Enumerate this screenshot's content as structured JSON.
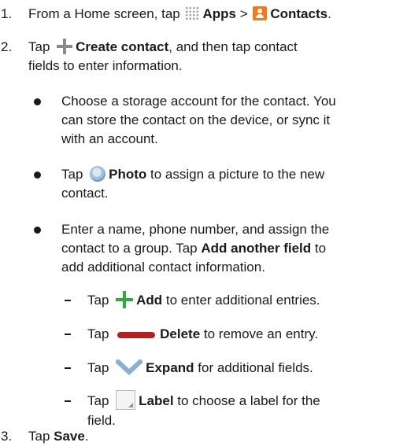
{
  "colors": {
    "contacts_icon": "#f07a1e",
    "add_icon": "#2eaa3e",
    "delete_icon": "#b32020",
    "expand_icon": "#8ab1cf",
    "create_icon": "#8a8a8a"
  },
  "icons": [
    "apps-grid-icon",
    "contacts-icon",
    "plus-icon",
    "photo-icon",
    "add-icon",
    "delete-icon",
    "expand-icon",
    "label-icon"
  ],
  "steps": [
    {
      "number": "1.",
      "prefix": "From a Home screen, tap ",
      "apps": "Apps",
      "sep": " > ",
      "contacts": "Contacts",
      "suffix": "."
    },
    {
      "number": "2.",
      "prefix": "Tap ",
      "create": "Create contact",
      "line1_rest": ", and then tap contact",
      "line2": "fields to enter information."
    },
    {
      "number": "3.",
      "prefix": "Tap ",
      "save": "Save",
      "suffix": "."
    }
  ],
  "bullets": {
    "storage": [
      "Choose a storage account for the contact. You",
      "can store the contact on the device, or sync it",
      "with an account."
    ],
    "photo": {
      "prefix": "Tap ",
      "bold": "Photo",
      "line1_rest": " to assign a picture to the new",
      "line2": "contact."
    },
    "name": {
      "line1": "Enter a name, phone number, and assign the",
      "line2_prefix": "contact to a group. Tap ",
      "line2_bold": "Add another field",
      "line2_rest": " to",
      "line3": "add additional contact information."
    }
  },
  "subitems": {
    "add": {
      "prefix": "Tap ",
      "bold": "Add",
      "rest": " to enter additional entries."
    },
    "delete": {
      "prefix": "Tap ",
      "bold": "Delete",
      "rest": " to remove an entry."
    },
    "expand": {
      "prefix": "Tap ",
      "bold": "Expand",
      "rest": " for additional fields."
    },
    "label": {
      "prefix": "Tap ",
      "bold": "Label",
      "line1_rest": " to choose a label for the",
      "line2": "field."
    }
  }
}
